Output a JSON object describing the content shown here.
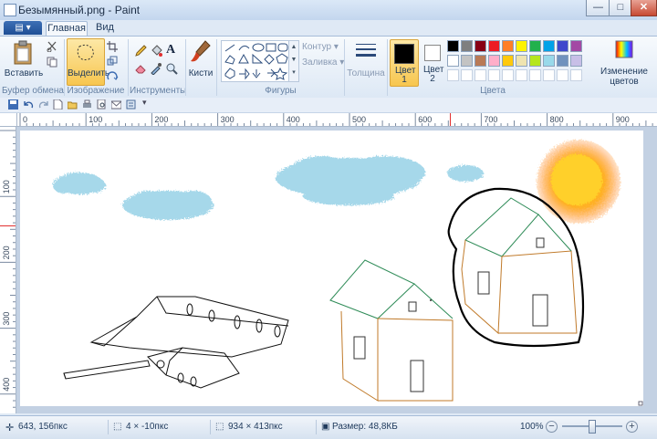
{
  "window": {
    "title": "Безымянный.png - Paint",
    "controls": {
      "minimize": "—",
      "maximize": "□",
      "close": "✕"
    }
  },
  "tabs": {
    "file": "▤ ▾",
    "home": "Главная",
    "view": "Вид"
  },
  "ribbon": {
    "clipboard": {
      "paste": "Вставить",
      "label": "Буфер обмена"
    },
    "image": {
      "select": "Выделить",
      "label": "Изображение"
    },
    "tools": {
      "label": "Инструменты"
    },
    "brushes": {
      "label": "Кисти"
    },
    "shapes": {
      "outline": "Контур",
      "fill": "Заливка",
      "label": "Фигуры"
    },
    "size": {
      "label": "Толщина"
    },
    "color1": {
      "label": "Цвет 1",
      "value": "#000000"
    },
    "color2": {
      "label": "Цвет 2",
      "value": "#ffffff"
    },
    "colors": {
      "label": "Цвета",
      "palette_row1": [
        "#000000",
        "#7f7f7f",
        "#880015",
        "#ed1c24",
        "#ff7f27",
        "#fff200",
        "#22b14c",
        "#00a2e8",
        "#3f48cc",
        "#a349a4"
      ],
      "palette_row2": [
        "#ffffff",
        "#c3c3c3",
        "#b97a57",
        "#ffaec9",
        "#ffc90e",
        "#efe4b0",
        "#b5e61d",
        "#99d9ea",
        "#7092be",
        "#c8bfe7"
      ]
    },
    "edit_colors": "Изменение цветов"
  },
  "rulers": {
    "h_ticks": [
      "0",
      "100",
      "200",
      "300",
      "400",
      "500",
      "600",
      "700",
      "800",
      "900"
    ],
    "v_ticks": [
      "100",
      "200",
      "300",
      "400"
    ]
  },
  "status": {
    "cursor": "643, 156пкс",
    "selection": "4 × -10пкс",
    "image_size": "934 × 413пкс",
    "file_size": "Размер: 48,8КБ",
    "zoom": "100%"
  }
}
